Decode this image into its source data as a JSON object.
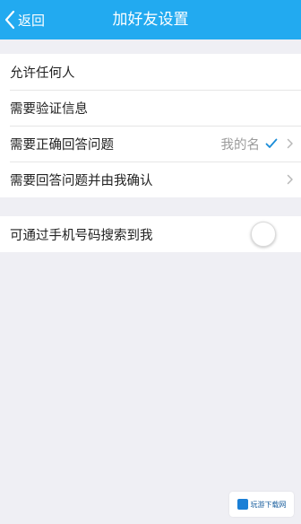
{
  "nav": {
    "back_label": "返回",
    "title": "加好友设置"
  },
  "options": [
    {
      "label": "允许任何人"
    },
    {
      "label": "需要验证信息"
    },
    {
      "label": "需要正确回答问题",
      "value": "我的名",
      "selected": true
    },
    {
      "label": "需要回答问题并由我确认"
    }
  ],
  "phone_search": {
    "label": "可通过手机号码搜索到我",
    "enabled": false
  },
  "watermark": {
    "text": "玩游下载网"
  },
  "colors": {
    "nav_bar": "#22aaf0",
    "background": "#efeff4",
    "check": "#1a8cd8"
  },
  "icons": [
    "back-chevron-icon",
    "check-icon",
    "chevron-right-icon"
  ]
}
